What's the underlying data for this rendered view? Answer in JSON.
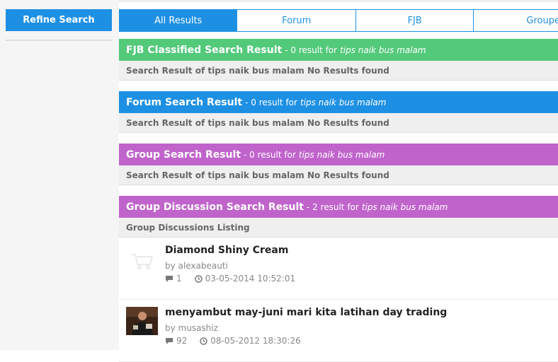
{
  "sidebar": {
    "refine_label": "Refine Search"
  },
  "tabs": [
    {
      "label": "All Results"
    },
    {
      "label": "Forum"
    },
    {
      "label": "FJB"
    },
    {
      "label": "Groupee"
    }
  ],
  "sections": {
    "fjb": {
      "title": "FJB Classified Search Result",
      "count_text": "- 0 result for",
      "query": "tips naik bus malam",
      "message": "Search Result of tips naik bus malam No Results found"
    },
    "forum": {
      "title": "Forum Search Result",
      "count_text": "- 0 result for",
      "query": "tips naik bus malam",
      "message": "Search Result of tips naik bus malam No Results found"
    },
    "group": {
      "title": "Group Search Result",
      "count_text": "- 0 result for",
      "query": "tips naik bus malam",
      "message": "Search Result of tips naik bus malam No Results found"
    },
    "discussion": {
      "title": "Group Discussion Search Result",
      "count_text": "- 2 result for",
      "query": "tips naik bus malam",
      "listing_label": "Group Discussions Listing",
      "items": [
        {
          "title": "Diamond Shiny Cream",
          "author": "by alexabeauti",
          "replies": "1",
          "date": "03-05-2014 10:52:01"
        },
        {
          "title": "menyambut may-juni mari kita latihan day trading",
          "author": "by musashiz",
          "replies": "92",
          "date": "08-05-2012 18:30:26"
        }
      ]
    }
  },
  "colors": {
    "accent": "#1e90e4",
    "fjb": "#53c97a",
    "forum": "#1e90e4",
    "group": "#c064cc"
  },
  "icons": {
    "replies": "comment-icon",
    "date": "clock-icon"
  }
}
